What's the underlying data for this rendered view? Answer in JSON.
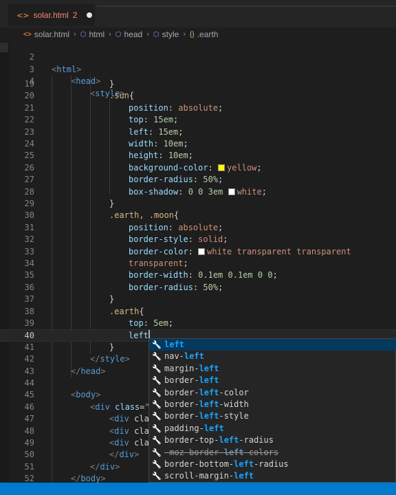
{
  "tab": {
    "icon": "html-file-icon",
    "filename": "solar.html",
    "problem_count": "2"
  },
  "breadcrumb": [
    {
      "icon": "html-file-icon",
      "icon_glyph": "<>",
      "label": "solar.html"
    },
    {
      "icon": "element-icon",
      "icon_glyph": "⬡",
      "label": "html"
    },
    {
      "icon": "element-icon",
      "icon_glyph": "⬡",
      "label": "head"
    },
    {
      "icon": "element-icon",
      "icon_glyph": "⬡",
      "label": "style"
    },
    {
      "icon": "selector-braces-icon",
      "icon_glyph": "{}",
      "label": ".earth"
    }
  ],
  "sticky_lines": [
    {
      "n": "2",
      "text": "<html>"
    },
    {
      "n": "3",
      "text": "<head>"
    },
    {
      "n": "4",
      "text": "<style>"
    }
  ],
  "lines": [
    {
      "n": "19",
      "text": "}"
    },
    {
      "n": "20",
      "text": ".sun{"
    },
    {
      "n": "21",
      "text": "position: absolute;"
    },
    {
      "n": "22",
      "text": "top: 15em;"
    },
    {
      "n": "23",
      "text": "left: 15em;"
    },
    {
      "n": "24",
      "text": "width: 10em;"
    },
    {
      "n": "25",
      "text": "height: 10em;"
    },
    {
      "n": "26",
      "text": "background-color: yellow;"
    },
    {
      "n": "27",
      "text": "border-radius: 50%;"
    },
    {
      "n": "28",
      "text": "box-shadow: 0 0 3em white;"
    },
    {
      "n": "29",
      "text": "}"
    },
    {
      "n": "30",
      "text": ".earth, .moon{"
    },
    {
      "n": "31",
      "text": "position: absolute;"
    },
    {
      "n": "32",
      "text": "border-style: solid;"
    },
    {
      "n": "33",
      "text": "border-color: white transparent transparent"
    },
    {
      "n": "34",
      "text": "transparent;"
    },
    {
      "n": "35",
      "text": "border-width: 0.1em 0.1em 0 0;"
    },
    {
      "n": "36",
      "text": "border-radius: 50%;"
    },
    {
      "n": "37",
      "text": "}"
    },
    {
      "n": "38",
      "text": ".earth{"
    },
    {
      "n": "39",
      "text": "top: 5em;"
    },
    {
      "n": "40",
      "text": "left"
    },
    {
      "n": "41",
      "text": "}"
    },
    {
      "n": "42",
      "text": "</style>"
    },
    {
      "n": "43",
      "text": "</head>"
    },
    {
      "n": "44",
      "text": ""
    },
    {
      "n": "45",
      "text": "<body>"
    },
    {
      "n": "46",
      "text": "<div class=\""
    },
    {
      "n": "47",
      "text": "<div cla"
    },
    {
      "n": "48",
      "text": "<div cla"
    },
    {
      "n": "49",
      "text": "<div cla"
    },
    {
      "n": "50",
      "text": "</div>"
    },
    {
      "n": "51",
      "text": "</div>"
    },
    {
      "n": "52",
      "text": "</body>"
    }
  ],
  "colors": {
    "yellow_swatch": "#ffff00",
    "white_swatch": "#ffffff",
    "accent": "#007acc",
    "match_highlight": "#18a3ff"
  },
  "suggestions": [
    {
      "pre": "",
      "match": "left",
      "post": "",
      "selected": true,
      "deprecated": false
    },
    {
      "pre": "nav-",
      "match": "left",
      "post": "",
      "selected": false,
      "deprecated": false
    },
    {
      "pre": "margin-",
      "match": "left",
      "post": "",
      "selected": false,
      "deprecated": false
    },
    {
      "pre": "border-",
      "match": "left",
      "post": "",
      "selected": false,
      "deprecated": false
    },
    {
      "pre": "border-",
      "match": "left",
      "post": "-color",
      "selected": false,
      "deprecated": false
    },
    {
      "pre": "border-",
      "match": "left",
      "post": "-width",
      "selected": false,
      "deprecated": false
    },
    {
      "pre": "border-",
      "match": "left",
      "post": "-style",
      "selected": false,
      "deprecated": false
    },
    {
      "pre": "padding-",
      "match": "left",
      "post": "",
      "selected": false,
      "deprecated": false
    },
    {
      "pre": "border-top-",
      "match": "left",
      "post": "-radius",
      "selected": false,
      "deprecated": false
    },
    {
      "pre": "-moz-border-",
      "match": "left",
      "post": "-colors",
      "selected": false,
      "deprecated": true
    },
    {
      "pre": "border-bottom-",
      "match": "left",
      "post": "-radius",
      "selected": false,
      "deprecated": false
    },
    {
      "pre": "scroll-margin-",
      "match": "left",
      "post": "",
      "selected": false,
      "deprecated": false
    }
  ]
}
